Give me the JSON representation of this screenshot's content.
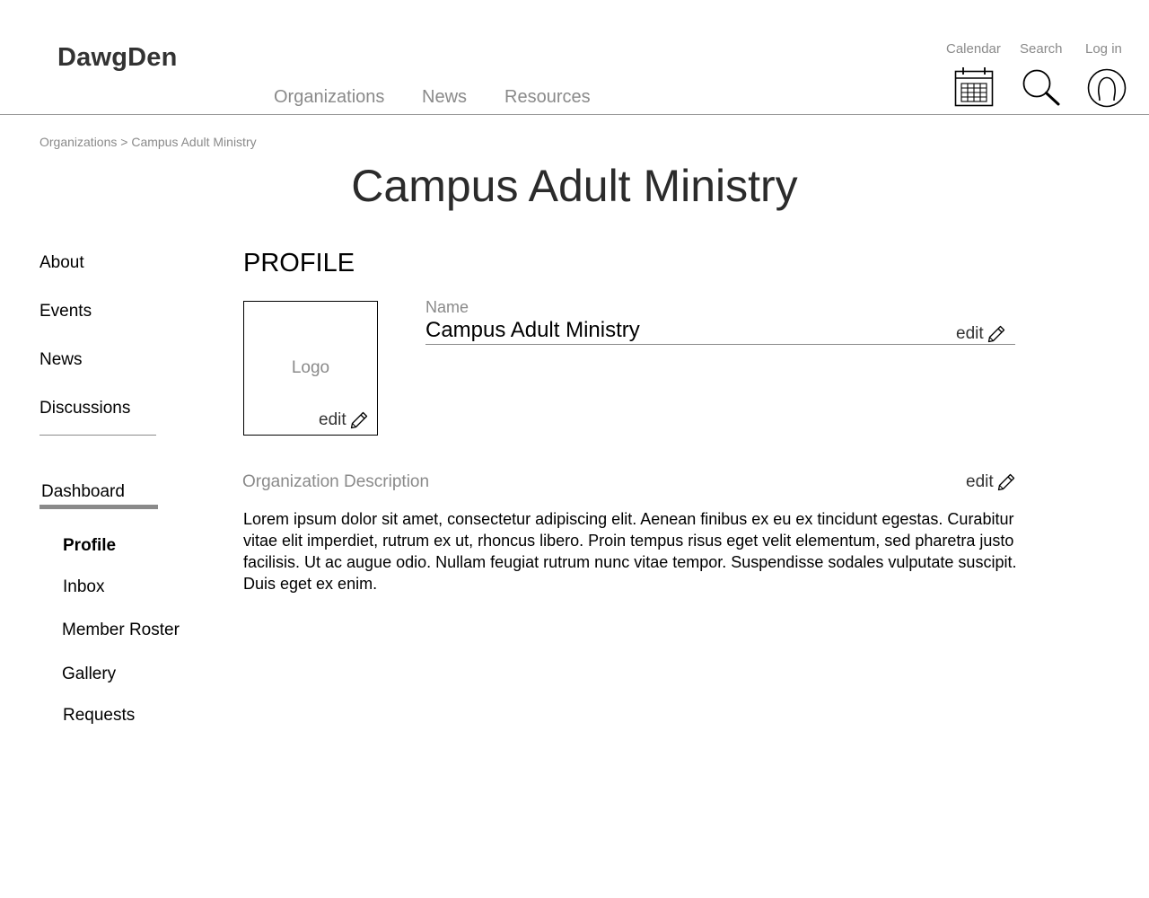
{
  "header": {
    "brand": "DawgDen",
    "nav": [
      {
        "label": "Organizations"
      },
      {
        "label": "News"
      },
      {
        "label": "Resources"
      }
    ],
    "utilities": [
      {
        "label": "Calendar",
        "icon": "calendar-icon"
      },
      {
        "label": "Search",
        "icon": "search-icon"
      },
      {
        "label": "Log in",
        "icon": "user-icon"
      }
    ]
  },
  "breadcrumb": "Organizations > Campus Adult Ministry",
  "page_title": "Campus Adult Ministry",
  "sidebar": {
    "items": [
      {
        "label": "About"
      },
      {
        "label": "Events"
      },
      {
        "label": "News"
      },
      {
        "label": "Discussions"
      }
    ],
    "dashboard": {
      "label": "Dashboard",
      "items": [
        {
          "label": "Profile",
          "active": true
        },
        {
          "label": "Inbox"
        },
        {
          "label": "Member Roster"
        },
        {
          "label": "Gallery"
        },
        {
          "label": "Requests"
        }
      ]
    }
  },
  "profile": {
    "section_title": "PROFILE",
    "logo_placeholder": "Logo",
    "logo_edit_label": "edit",
    "name_label": "Name",
    "name_value": "Campus Adult Ministry",
    "name_edit_label": "edit",
    "description_label": "Organization Description",
    "description_edit_label": "edit",
    "description": "Lorem ipsum dolor sit amet, consectetur adipiscing elit. Aenean finibus ex eu ex tincidunt egestas. Curabitur vitae elit imperdiet, rutrum ex ut, rhoncus libero. Proin tempus risus eget velit elementum, sed pharetra justo facilisis. Ut ac augue odio. Nullam feugiat rutrum nunc vitae tempor. Suspendisse sodales vulputate suscipit. Duis eget ex enim."
  },
  "colors": {
    "text": "#000000",
    "muted": "#8a8a8a",
    "brand": "#333333",
    "rule": "#9a9a9a"
  }
}
